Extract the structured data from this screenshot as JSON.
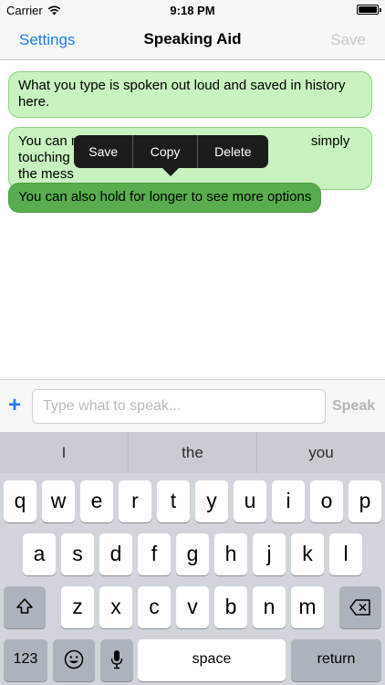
{
  "status_bar": {
    "carrier": "Carrier",
    "time": "9:18 PM"
  },
  "nav": {
    "left_button": "Settings",
    "title": "Speaking Aid",
    "right_button": "Save"
  },
  "messages": [
    {
      "text": "What you type is spoken out loud and saved in history here.",
      "selected": false
    },
    {
      "text": "You can replay previous messages by simply touching the message",
      "selected": false
    },
    {
      "text": "You can also hold for longer to see more options",
      "selected": true
    }
  ],
  "visible_fragments": {
    "msg2_line1": "You can r",
    "msg2_line1_end": "simply touching",
    "msg2_line2": "the mess"
  },
  "context_menu": {
    "items": [
      "Save",
      "Copy",
      "Delete"
    ]
  },
  "input_bar": {
    "add_icon": "+",
    "placeholder": "Type what to speak...",
    "speak_button": "Speak"
  },
  "keyboard": {
    "suggestions": [
      "I",
      "the",
      "you"
    ],
    "row1": [
      "q",
      "w",
      "e",
      "r",
      "t",
      "y",
      "u",
      "i",
      "o",
      "p"
    ],
    "row2": [
      "a",
      "s",
      "d",
      "f",
      "g",
      "h",
      "j",
      "k",
      "l"
    ],
    "row3": [
      "z",
      "x",
      "c",
      "v",
      "b",
      "n",
      "m"
    ],
    "numbers_key": "123",
    "space_key": "space",
    "return_key": "return",
    "icons": {
      "shift": "shift-icon",
      "backspace": "backspace-icon",
      "emoji": "emoji-icon",
      "mic": "microphone-icon"
    }
  },
  "colors": {
    "accent": "#1e7cf2",
    "bubble": "#c8f2bf",
    "bubble_selected": "#59ad4e",
    "menu": "#1c1c1c"
  }
}
